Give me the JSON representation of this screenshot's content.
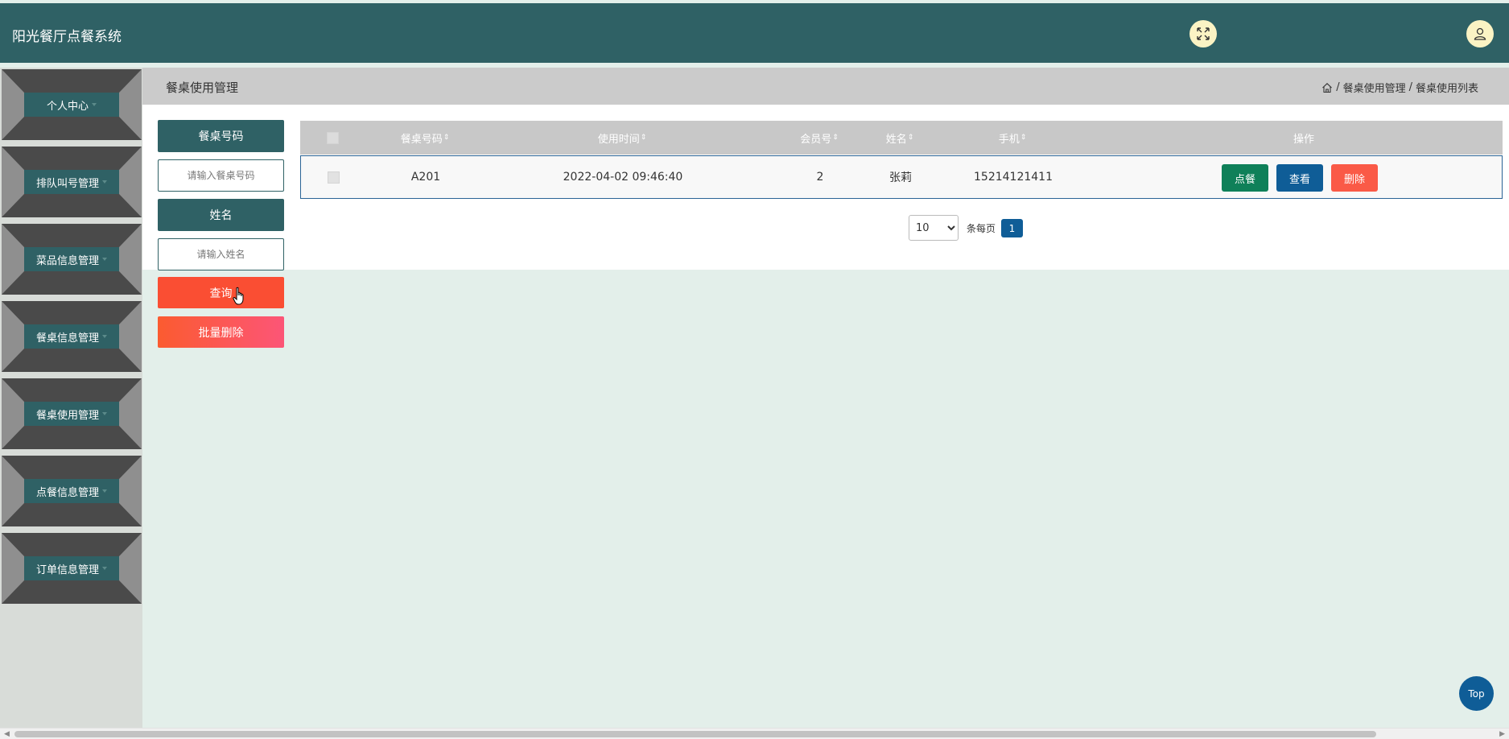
{
  "app": {
    "title": "阳光餐厅点餐系统"
  },
  "header": {
    "fullscreen_icon": "fullscreen-icon",
    "user_icon": "user-icon"
  },
  "sidebar": {
    "items": [
      {
        "label": "个人中心"
      },
      {
        "label": "排队叫号管理"
      },
      {
        "label": "菜品信息管理"
      },
      {
        "label": "餐桌信息管理"
      },
      {
        "label": "餐桌使用管理"
      },
      {
        "label": "点餐信息管理"
      },
      {
        "label": "订单信息管理"
      }
    ]
  },
  "breadcrumb": {
    "title": "餐桌使用管理",
    "path": [
      "餐桌使用管理",
      "餐桌使用列表"
    ],
    "separator": "/"
  },
  "search": {
    "table_no_label": "餐桌号码",
    "table_no_placeholder": "请输入餐桌号码",
    "table_no_value": "",
    "name_label": "姓名",
    "name_placeholder": "请输入姓名",
    "name_value": "",
    "query_label": "查询",
    "batch_delete_label": "批量删除"
  },
  "table": {
    "columns": [
      "餐桌号码",
      "使用时间",
      "会员号",
      "姓名",
      "手机",
      "操作"
    ],
    "rows": [
      {
        "table_no": "A201",
        "use_time": "2022-04-02 09:46:40",
        "member_no": "2",
        "name": "张莉",
        "phone": "15214121411",
        "actions": [
          "点餐",
          "查看",
          "删除"
        ]
      }
    ]
  },
  "pagination": {
    "page_size": "10",
    "page_size_options": [
      "10"
    ],
    "per_page_label": "条每页",
    "current_page": "1"
  },
  "top_button": {
    "label": "Top"
  },
  "colors": {
    "primary": "#2f6165",
    "order_btn": "#0f8059",
    "view_btn": "#0f5d97",
    "delete_btn": "#fa5a47",
    "query_btn": "#fa4e33",
    "background": "#e3efea"
  }
}
